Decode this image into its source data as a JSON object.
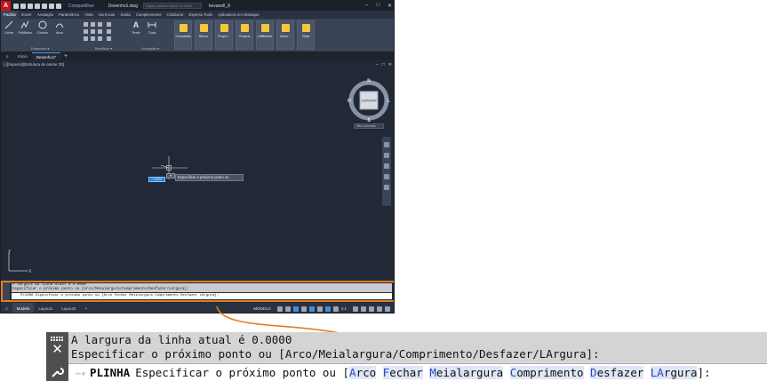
{
  "titlebar": {
    "app_logo": "A",
    "share_label": "Compartilhar",
    "document_title": "Desenho1.dwg",
    "search_placeholder": "Digite palavra-chave ou frase",
    "user_label": "kevanell_8"
  },
  "menu_tabs": [
    {
      "label": "Padrão",
      "active": true
    },
    {
      "label": "Inserir"
    },
    {
      "label": "Anotação"
    },
    {
      "label": "Paramétrico"
    },
    {
      "label": "Vista"
    },
    {
      "label": "Gerenciar"
    },
    {
      "label": "Saída"
    },
    {
      "label": "Complementos"
    },
    {
      "label": "Colaborar"
    },
    {
      "label": "Express Tools"
    },
    {
      "label": "Aplicativos em destaque"
    }
  ],
  "ribbon": {
    "tools": {
      "linha": "Linha",
      "polilinha": "Polilinha",
      "circulo": "Círculo",
      "arco": "Arco",
      "texto": "Texto",
      "cota": "Cota"
    },
    "buttons": {
      "camadas": "Camadas",
      "bloco": "Bloco",
      "propriedades": "Propri...",
      "grupos": "Grupos",
      "utilitarios": "Utilitários",
      "area": "Área...",
      "vista": "Vista"
    },
    "groups": {
      "desenhar": "Desenhar ▾",
      "modificar": "Modificar ▾",
      "anotacao": "Anotação ▾"
    }
  },
  "doc_tabs": {
    "inicio": "Início",
    "desenho": "Desenho1*"
  },
  "viewport": {
    "view_label": "[-][Superior][Estrutura de arame 2D]",
    "viewcube": {
      "north": "N",
      "south": "S",
      "east": "L",
      "west": "O",
      "face": "SUPERIOR"
    },
    "wcs_label": "Não nomeado",
    "dyn_input_value": "0.0000",
    "dyn_prompt": "Especificar o próximo ponto ou",
    "ucs": {
      "x": "X",
      "y": "Y"
    }
  },
  "cmdline_small": {
    "history_line1": "A largura da linha atual é 0.0000",
    "history_line2": "Especificar o próximo ponto ou [Arco/Meialargura/Comprimento/Desfazer/LArgura]:",
    "input_text": "PLINHA Especificar o próximo ponto ou [Arco Fechar Meialargura Comprimento Desfazer LArgura]:"
  },
  "statusbar": {
    "tabs": [
      {
        "label": "Modelo",
        "active": true
      },
      {
        "label": "Layout1"
      },
      {
        "label": "Layout2"
      }
    ],
    "model_label": "MODELO",
    "scale": "1:1"
  },
  "cmdline_big": {
    "history_line1": "A largura da linha atual é 0.0000",
    "history_line2": "Especificar o próximo ponto ou [Arco/Meialargura/Comprimento/Desfazer/LArgura]:",
    "command_name": "PLINHA",
    "prompt": "Especificar o próximo ponto ou [",
    "options": [
      {
        "hotkey": "A",
        "rest": "rco"
      },
      {
        "hotkey": "F",
        "rest": "echar"
      },
      {
        "hotkey": "M",
        "rest": "eialargura"
      },
      {
        "hotkey": "C",
        "rest": "omprimento"
      },
      {
        "hotkey": "D",
        "rest": "esfazer"
      },
      {
        "hotkey": "LA",
        "rest": "rgura"
      }
    ],
    "suffix": "]:"
  },
  "colors": {
    "accent_orange": "#e57c22",
    "selection_blue": "#1e78d8",
    "hotkey_blue": "#2447c7"
  }
}
